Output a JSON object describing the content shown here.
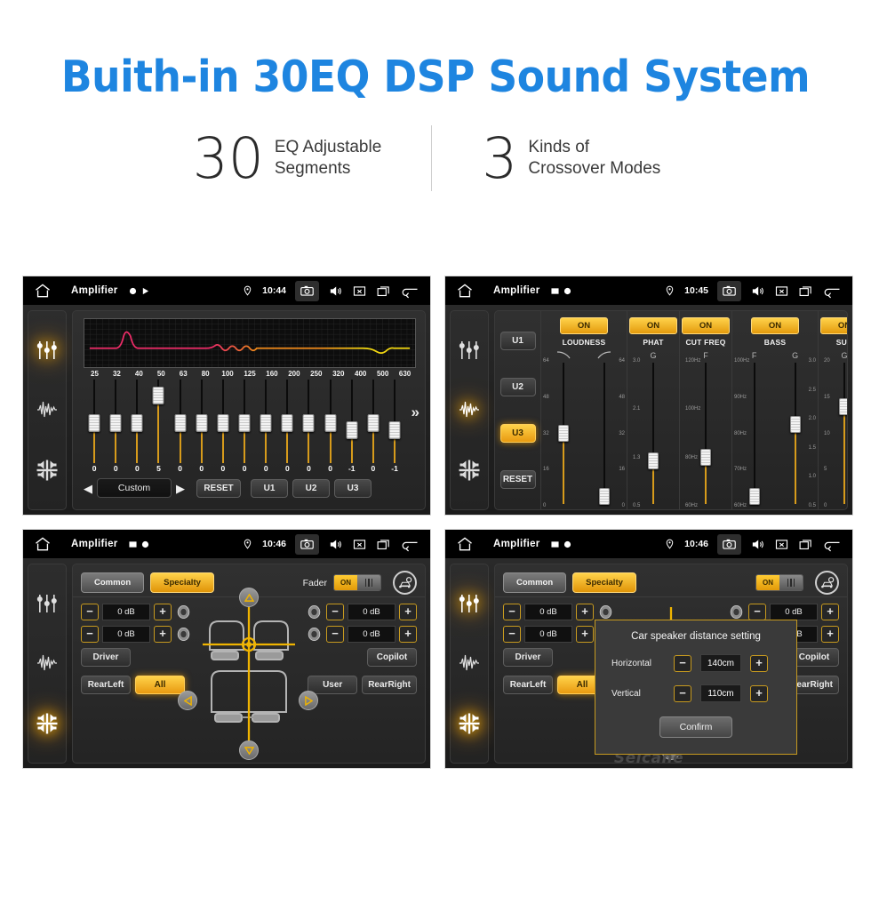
{
  "header": {
    "title": "Buith-in 30EQ DSP Sound System",
    "title_color": "#1e85e0",
    "stats": [
      {
        "number": "30",
        "line1": "EQ Adjustable",
        "line2": "Segments"
      },
      {
        "number": "3",
        "line1": "Kinds of",
        "line2": "Crossover Modes"
      }
    ]
  },
  "accent": {
    "amber": "#e8a70d",
    "amber_light": "#ffd24a",
    "rail": "#d79b1b"
  },
  "statusbar": {
    "app_title": "Amplifier",
    "icons": {
      "home": "home-icon",
      "location": "location-pin-icon",
      "camera": "camera-icon",
      "volume": "volume-icon",
      "close": "close-box-icon",
      "recents": "recents-icon",
      "back": "back-arrow-icon"
    }
  },
  "rail": {
    "items": [
      {
        "name": "equalizer-icon"
      },
      {
        "name": "waveform-icon"
      },
      {
        "name": "balance-icon"
      }
    ]
  },
  "panel_eq": {
    "time": "10:44",
    "active_rail": 0,
    "frequencies": [
      "25",
      "32",
      "40",
      "50",
      "63",
      "80",
      "100",
      "125",
      "160",
      "200",
      "250",
      "320",
      "400",
      "500",
      "630"
    ],
    "values": [
      "0",
      "0",
      "0",
      "5",
      "0",
      "0",
      "0",
      "0",
      "0",
      "0",
      "0",
      "0",
      "-1",
      "0",
      "-1"
    ],
    "knob_positions": [
      42,
      42,
      42,
      8,
      42,
      42,
      42,
      42,
      42,
      42,
      42,
      42,
      50,
      42,
      50
    ],
    "preset_prev": "◀",
    "preset_name": "Custom",
    "preset_next": "▶",
    "reset_label": "RESET",
    "user_presets": [
      "U1",
      "U2",
      "U3"
    ],
    "more_label": "»",
    "curve": {
      "stroke_left": "#ee2c68",
      "stroke_mid": "#ef8a1b",
      "stroke_right": "#f2d711"
    }
  },
  "panel_crossover": {
    "time": "10:45",
    "active_rail": 1,
    "presets": [
      "U1",
      "U2",
      "U3"
    ],
    "active_preset": "U3",
    "reset_label": "RESET",
    "columns": [
      {
        "name": "LOUDNESS",
        "on_label": "ON",
        "headers": [
          "curve-low-icon",
          "curve-high-icon"
        ],
        "sliders": [
          {
            "ticks": [
              "64",
              "48",
              "32",
              "16",
              "0"
            ],
            "knob_pct": 44
          },
          {
            "ticks": [
              "64",
              "48",
              "32",
              "16",
              "0"
            ],
            "knob_pct": 88
          }
        ]
      },
      {
        "name": "PHAT",
        "on_label": "ON",
        "headers": [
          "G"
        ],
        "sliders": [
          {
            "ticks": [
              "3.0",
              "2.1",
              "1.3",
              "0.5"
            ],
            "knob_pct": 63
          }
        ]
      },
      {
        "name": "CUT FREQ",
        "on_label": "ON",
        "headers": [
          "F"
        ],
        "sliders": [
          {
            "ticks": [
              "120Hz",
              "100Hz",
              "80Hz",
              "60Hz"
            ],
            "knob_pct": 61
          }
        ]
      },
      {
        "name": "BASS",
        "on_label": "ON",
        "headers": [
          "F",
          "G"
        ],
        "sliders": [
          {
            "ticks": [
              "100Hz",
              "90Hz",
              "80Hz",
              "70Hz",
              "60Hz"
            ],
            "knob_pct": 88
          },
          {
            "ticks": [
              "3.0",
              "2.5",
              "2.0",
              "1.5",
              "1.0",
              "0.5"
            ],
            "knob_pct": 38
          }
        ]
      },
      {
        "name": "SUB",
        "on_label": "ON",
        "headers": [
          "G"
        ],
        "sliders": [
          {
            "ticks": [
              "20",
              "15",
              "10",
              "5",
              "0"
            ],
            "knob_pct": 26
          }
        ]
      }
    ]
  },
  "panel_balance": {
    "time": "10:46",
    "active_rail": 2,
    "tabs": [
      {
        "label": "Common",
        "active": false
      },
      {
        "label": "Specialty",
        "active": true
      }
    ],
    "fader_label": "Fader",
    "fader_state": "ON",
    "gear_icon": "car-settings-icon",
    "levels": [
      {
        "minus": "−",
        "value": "0 dB",
        "plus": "+"
      },
      {
        "minus": "−",
        "value": "0 dB",
        "plus": "+"
      },
      {
        "minus": "−",
        "value": "0 dB",
        "plus": "+"
      },
      {
        "minus": "−",
        "value": "0 dB",
        "plus": "+"
      }
    ],
    "seat_buttons_left": [
      "Driver",
      "RearLeft"
    ],
    "seat_buttons_right": [
      "Copilot",
      "RearRight"
    ],
    "all_label": "All",
    "user_label": "User"
  },
  "panel_dialog": {
    "time": "10:46",
    "active_rail": 0,
    "title": "Car speaker distance setting",
    "rows": [
      {
        "label": "Horizontal",
        "minus": "−",
        "value": "140cm",
        "plus": "+"
      },
      {
        "label": "Vertical",
        "minus": "−",
        "value": "110cm",
        "plus": "+"
      }
    ],
    "confirm_label": "Confirm",
    "watermark": "Seicane"
  }
}
